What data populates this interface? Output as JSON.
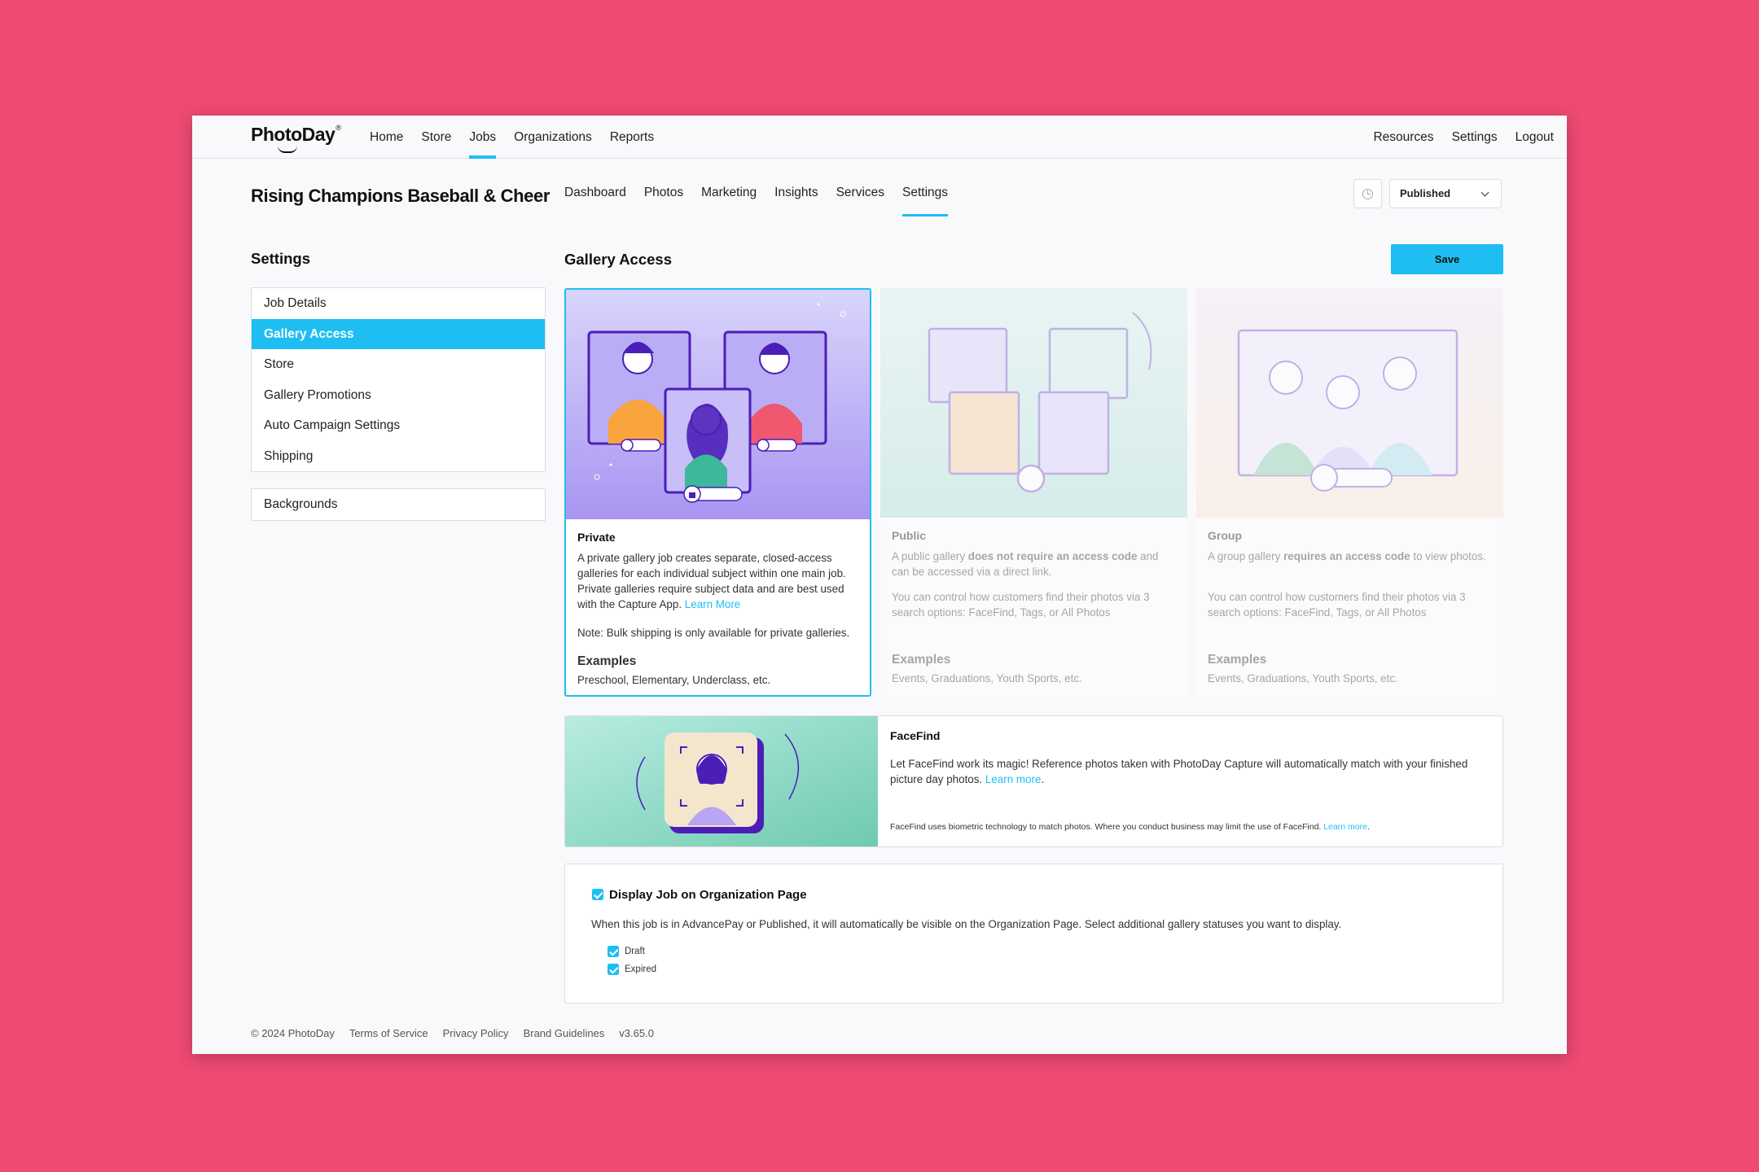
{
  "brand": {
    "name": "PhotoDay",
    "tm": "®"
  },
  "topnav": {
    "left": [
      "Home",
      "Store",
      "Jobs",
      "Organizations",
      "Reports"
    ],
    "right": [
      "Resources",
      "Settings",
      "Logout"
    ],
    "active": "Jobs"
  },
  "job": {
    "title": "Rising Champions Baseball & Cheer"
  },
  "subnav": {
    "items": [
      "Dashboard",
      "Photos",
      "Marketing",
      "Insights",
      "Services",
      "Settings"
    ],
    "active": "Settings"
  },
  "status": {
    "selected": "Published",
    "icon": "history-clock-icon"
  },
  "sidebar": {
    "title": "Settings",
    "group1": [
      "Job Details",
      "Gallery Access",
      "Store",
      "Gallery Promotions",
      "Auto Campaign Settings",
      "Shipping"
    ],
    "group2": [
      "Backgrounds"
    ],
    "active": "Gallery Access"
  },
  "main": {
    "title": "Gallery Access",
    "save_label": "Save"
  },
  "cards": [
    {
      "title": "Private",
      "desc": "A private gallery job creates separate, closed-access galleries for each individual subject within one main job. Private galleries require subject data and are best used with the Capture App.",
      "link": "Learn More",
      "note": "Note: Bulk shipping is only available for private galleries.",
      "examples_label": "Examples",
      "examples": "Preschool, Elementary, Underclass, etc."
    },
    {
      "title": "Public",
      "desc_pre": "A public gallery ",
      "desc_bold": "does not require an access code",
      "desc_post": " and can be accessed via a direct link.",
      "desc2": "You can control how customers find their photos via 3 search options: FaceFind, Tags, or All Photos",
      "examples_label": "Examples",
      "examples": "Events, Graduations, Youth Sports, etc."
    },
    {
      "title": "Group",
      "desc_pre": "A group gallery ",
      "desc_bold": "requires an access code",
      "desc_post": " to view photos.",
      "desc2": "You can control how customers find their photos via 3 search options: FaceFind, Tags, or All Photos",
      "examples_label": "Examples",
      "examples": "Events, Graduations, Youth Sports, etc."
    }
  ],
  "facefind": {
    "title": "FaceFind",
    "desc": "Let FaceFind work its magic! Reference photos taken with PhotoDay Capture will automatically match with your finished picture day photos.",
    "link": "Learn more",
    "note": "FaceFind uses biometric technology to match photos. Where you conduct business may limit the use of FaceFind.",
    "note_link": "Learn more"
  },
  "display": {
    "title": "Display Job on Organization Page",
    "desc": "When this job is in AdvancePay or Published, it will automatically be visible on the Organization Page. Select additional gallery statuses you want to display.",
    "options": [
      "Draft",
      "Expired"
    ],
    "checked": true
  },
  "footer": {
    "copyright": "© 2024 PhotoDay",
    "links": [
      "Terms of Service",
      "Privacy Policy",
      "Brand Guidelines"
    ],
    "version": "v3.65.0"
  },
  "colors": {
    "accent": "#1EBEF2",
    "background": "#EE4A72",
    "window": "#F9F9FC"
  }
}
